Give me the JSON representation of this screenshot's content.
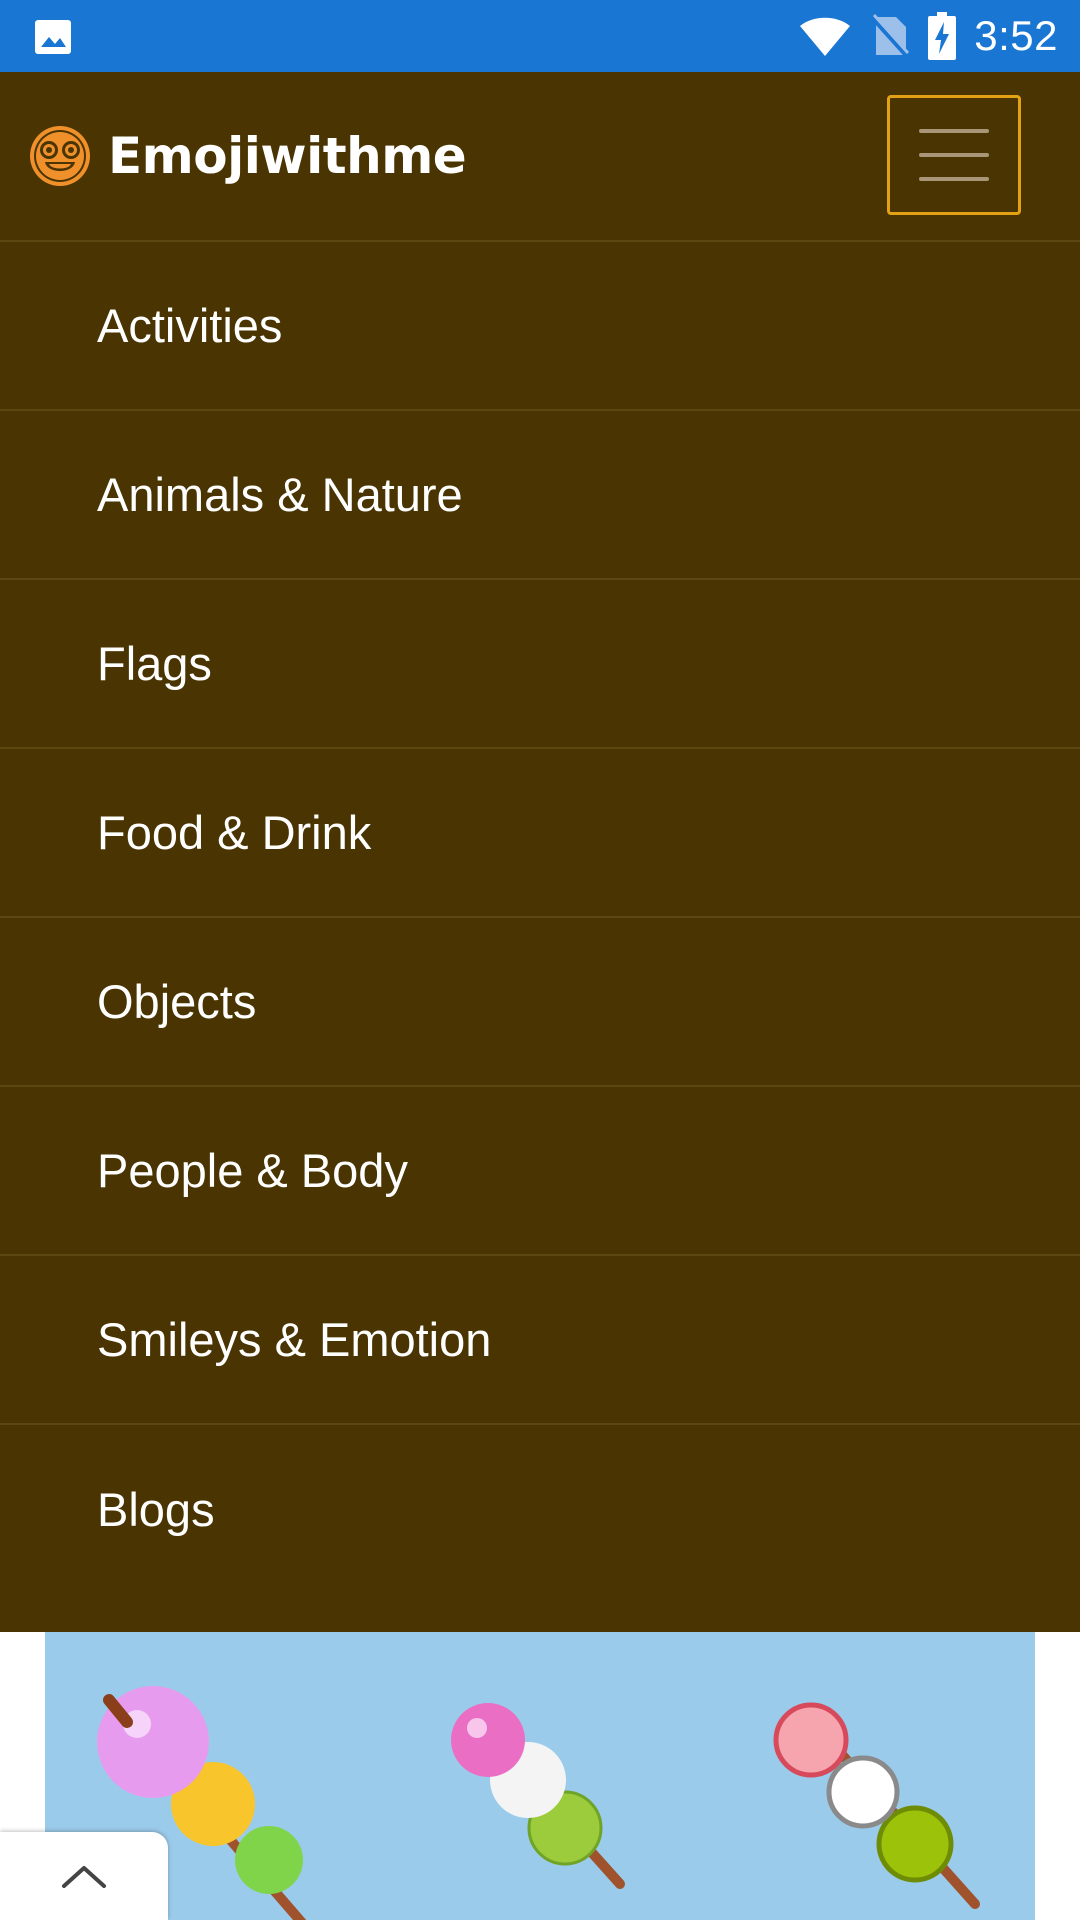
{
  "status_bar": {
    "time": "3:52",
    "icons": [
      "gallery-icon",
      "wifi-icon",
      "no-sim-icon",
      "battery-charging-icon"
    ],
    "background": "#1976d2"
  },
  "navbar": {
    "brand_name": "Emojiwithme",
    "logo_icon": "grinning-face-with-glasses-icon",
    "toggler_icon": "hamburger-menu-icon",
    "background": "#4a3502",
    "accent": "#e3a215"
  },
  "menu": {
    "items": [
      {
        "label": "Activities"
      },
      {
        "label": "Animals & Nature"
      },
      {
        "label": "Flags"
      },
      {
        "label": "Food & Drink"
      },
      {
        "label": "Objects"
      },
      {
        "label": "People & Body"
      },
      {
        "label": "Smileys & Emotion"
      },
      {
        "label": "Blogs"
      }
    ]
  },
  "banner": {
    "image": "dango-emoji-banner",
    "background": "#9bcbea"
  },
  "scroll_top": {
    "icon": "chevron-up-icon"
  }
}
